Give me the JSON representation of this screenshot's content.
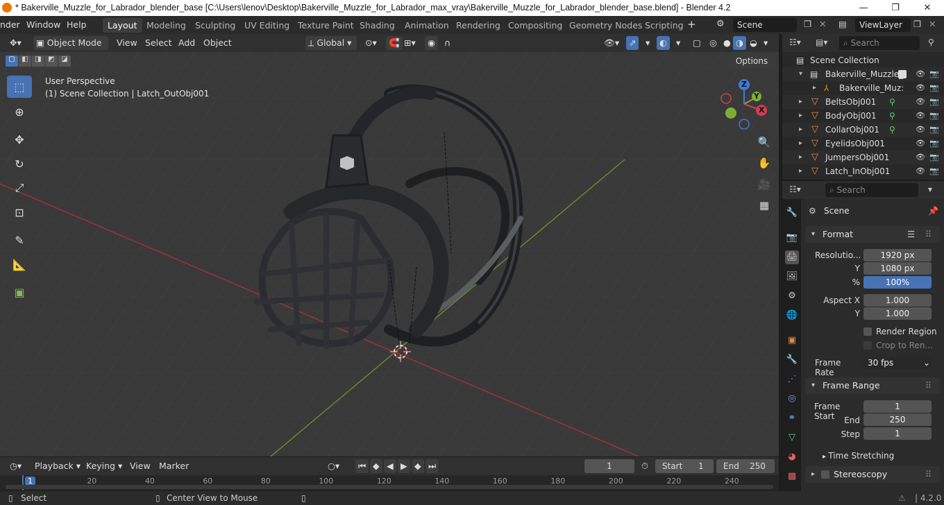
{
  "window": {
    "title": "* Bakerville_Muzzle_for_Labrador_blender_base [C:\\Users\\lenov\\Desktop\\Bakerville_Muzzle_for_Labrador_max_vray\\Bakerville_Muzzle_for_Labrador_blender_base.blend] - Blender 4.2",
    "minimize": "—",
    "maximize": "❐",
    "close": "✕"
  },
  "menu": [
    "nder",
    "Window",
    "Help"
  ],
  "workspaces": [
    "Layout",
    "Modeling",
    "Sculpting",
    "UV Editing",
    "Texture Paint",
    "Shading",
    "Animation",
    "Rendering",
    "Compositing",
    "Geometry Nodes",
    "Scripting"
  ],
  "workspace_add": "+",
  "scene_field": "Scene",
  "viewlayer_field": "ViewLayer",
  "viewport_header": {
    "mode": "Object Mode",
    "menus": [
      "View",
      "Select",
      "Add",
      "Object"
    ],
    "orientation": "Global",
    "options": "Options"
  },
  "viewport": {
    "perspective": "User Perspective",
    "collection": "(1) Scene Collection | Latch_OutObj001",
    "gizmo": {
      "z": "Z",
      "y": "Y",
      "x": "X"
    }
  },
  "outliner": {
    "search_placeholder": "Search",
    "root": "Scene Collection",
    "collection": "Bakerville_Muzzle_f",
    "items": [
      {
        "name": "Bakerville_Muz:",
        "type": "armature"
      },
      {
        "name": "BeltsObj001",
        "type": "mesh"
      },
      {
        "name": "BodyObj001",
        "type": "mesh"
      },
      {
        "name": "CollarObj001",
        "type": "mesh"
      },
      {
        "name": "EyelidsObj001",
        "type": "mesh"
      },
      {
        "name": "JumpersObj001",
        "type": "mesh"
      },
      {
        "name": "Latch_InObj001",
        "type": "mesh"
      }
    ]
  },
  "properties": {
    "search_placeholder": "Search",
    "context": "Scene",
    "format": {
      "title": "Format",
      "resolution_x_label": "Resolutio...",
      "resolution_x": "1920 px",
      "resolution_y_label": "Y",
      "resolution_y": "1080 px",
      "percent_label": "%",
      "percent": "100%",
      "percent_fill": 1.0,
      "aspect_x_label": "Aspect X",
      "aspect_x": "1.000",
      "aspect_y_label": "Y",
      "aspect_y": "1.000",
      "render_region": "Render Region",
      "crop": "Crop to Ren...",
      "frame_rate_label": "Frame Rate",
      "frame_rate": "30 fps"
    },
    "frame_range": {
      "title": "Frame Range",
      "start_label": "Frame Start",
      "start": "1",
      "end_label": "End",
      "end": "250",
      "step_label": "Step",
      "step": "1"
    },
    "time_stretching": "Time Stretching",
    "stereoscopy": "Stereoscopy"
  },
  "timeline": {
    "menus": [
      "Playback",
      "Keying",
      "View",
      "Marker"
    ],
    "current_frame": "1",
    "start_label": "Start",
    "start": "1",
    "end_label": "End",
    "end": "250",
    "ticks": [
      "1",
      "20",
      "40",
      "60",
      "80",
      "100",
      "120",
      "140",
      "160",
      "180",
      "200",
      "220",
      "240"
    ]
  },
  "statusbar": {
    "select": "Select",
    "center": "Center View to Mouse",
    "version": "4.2.0"
  },
  "colors": {
    "accent": "#4772b3",
    "orange": "#ea7600",
    "x_axis": "#c8313f",
    "y_axis": "#6f9a2c"
  }
}
